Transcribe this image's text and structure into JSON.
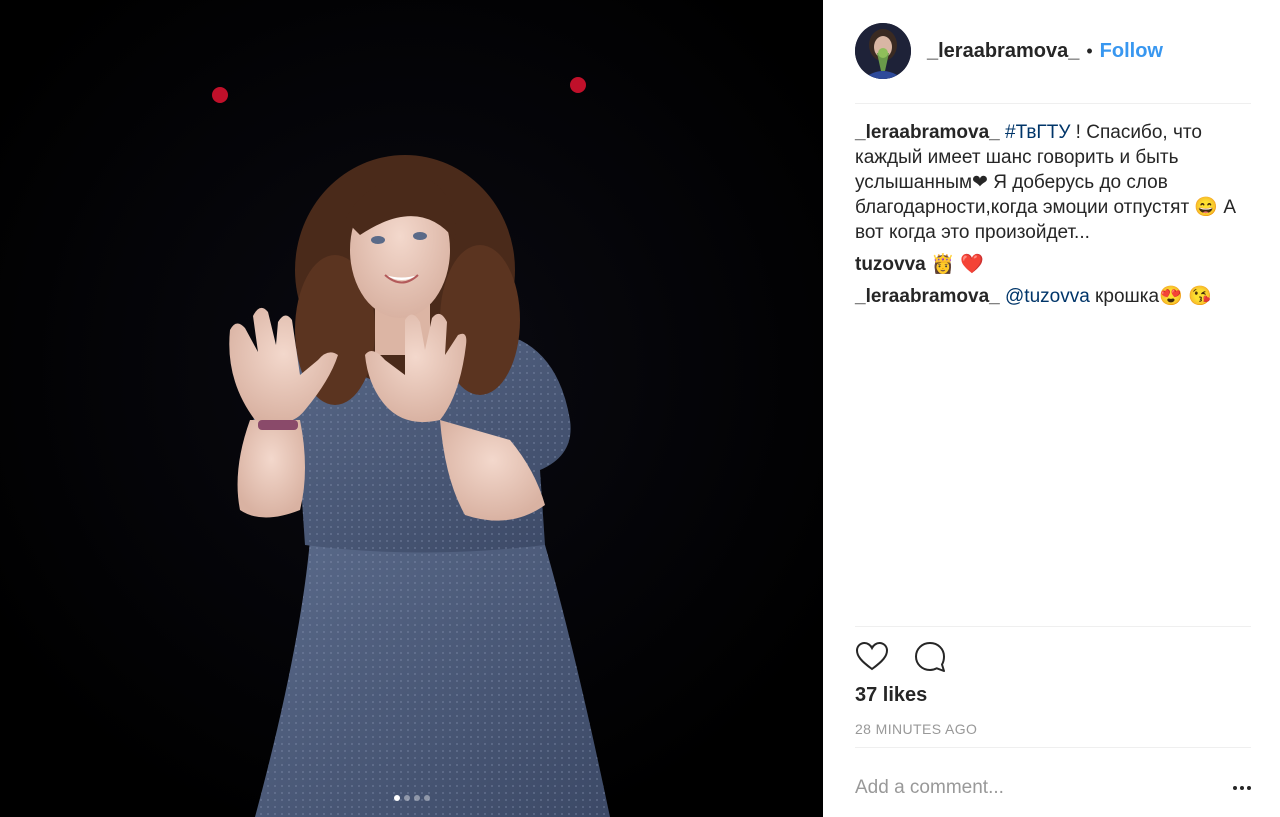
{
  "post": {
    "username": "_leraabramova_",
    "separator": "•",
    "follow_label": "Follow"
  },
  "carousel": {
    "total": 4,
    "active": 1
  },
  "caption": {
    "author": "_leraabramova_",
    "hashtag": "#ТвГТУ",
    "text": " ! Спасибо, что каждый имеет шанс говорить и быть услышанным❤ Я доберусь до слов благодарности,когда эмоции отпустят 😄 А вот когда это произойдет..."
  },
  "comments": [
    {
      "author": "tuzovva",
      "mention": "",
      "text": " 👸 ❤️"
    },
    {
      "author": "_leraabramova_",
      "mention": "@tuzovva",
      "text": " крошка😍 😘"
    }
  ],
  "actions": {
    "like_icon": "heart-icon",
    "comment_icon": "comment-icon"
  },
  "likes_label": "37 likes",
  "timestamp": "28 MINUTES AGO",
  "comment_input": {
    "placeholder": "Add a comment...",
    "value": ""
  },
  "colors": {
    "accent": "#3897f0",
    "link": "#003569",
    "muted": "#999999",
    "photo_background": "#000000",
    "dress": "#4a5a78"
  }
}
